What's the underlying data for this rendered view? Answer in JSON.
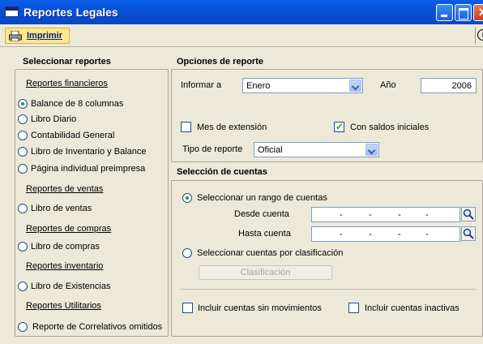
{
  "window": {
    "title": "Reportes Legales"
  },
  "toolbar": {
    "print_label": "Imprimir",
    "info_glyph": "i"
  },
  "left": {
    "title": "Seleccionar reportes",
    "categories": [
      {
        "label": "Reportes financieros",
        "items": [
          "Balance de 8 columnas",
          "Libro Diario",
          "Contabilidad General",
          "Libro de Inventario y Balance",
          "Página individual preimpresa"
        ]
      },
      {
        "label": "Reportes de ventas",
        "items": [
          "Libro de ventas"
        ]
      },
      {
        "label": "Reportes de compras",
        "items": [
          "Libro de compras"
        ]
      },
      {
        "label": "Reportes inventario",
        "items": [
          "Libro de Existencias"
        ]
      },
      {
        "label": "Reportes Utilitarios",
        "items": [
          "Reporte de Correlativos omitidos"
        ]
      }
    ],
    "selected": "Balance de 8 columnas"
  },
  "options": {
    "title": "Opciones de reporte",
    "informar_label": "Informar a",
    "informar_value": "Enero",
    "year_label": "Año",
    "year_value": "2006",
    "mes_ext_label": "Mes de extensión",
    "saldos_label": "Con saldos iniciales",
    "tipo_label": "Tipo de reporte",
    "tipo_value": "Oficial"
  },
  "accounts": {
    "title": "Selección de cuentas",
    "range_label": "Seleccionar un rango de cuentas",
    "desde_label": "Desde cuenta",
    "hasta_label": "Hasta cuenta",
    "mask": [
      "-",
      "-",
      "-",
      "-"
    ],
    "class_label": "Seleccionar cuentas por clasificación",
    "class_button": "Clasificación",
    "sin_mov_label": "Incluir cuentas sin movimientos",
    "inactivas_label": "Incluir cuentas inactivas"
  }
}
